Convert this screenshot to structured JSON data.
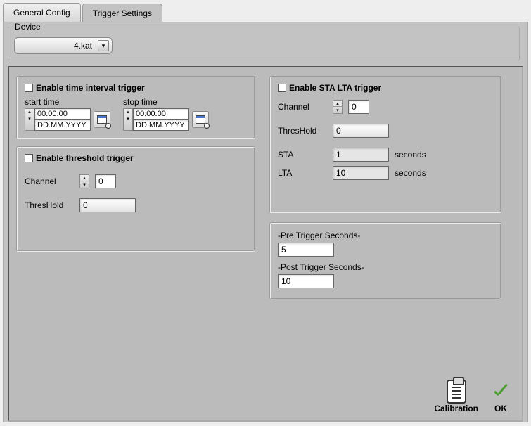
{
  "tabs": {
    "general": "General Config",
    "trigger": "Trigger Settings"
  },
  "device": {
    "label": "Device",
    "selected": "4.kat"
  },
  "time_trigger": {
    "title": "Enable time interval trigger",
    "start_label": "start time",
    "stop_label": "stop time",
    "start_time": "00:00:00",
    "start_date": "DD.MM.YYYY",
    "stop_time": "00:00:00",
    "stop_date": "DD.MM.YYYY"
  },
  "threshold_trigger": {
    "title": "Enable threshold trigger",
    "channel_label": "Channel",
    "channel": "0",
    "thres_label": "ThresHold",
    "thres": "0"
  },
  "sta_lta": {
    "title": "Enable STA LTA trigger",
    "channel_label": "Channel",
    "channel": "0",
    "thres_label": "ThresHold",
    "thres": "0",
    "sta_label": "STA",
    "sta": "1",
    "lta_label": "LTA",
    "lta": "10",
    "seconds": "seconds"
  },
  "prepost": {
    "pre_label": "-Pre Trigger Seconds-",
    "pre": "5",
    "post_label": "-Post Trigger Seconds-",
    "post": "10"
  },
  "footer": {
    "calibration": "Calibration",
    "ok": "OK"
  }
}
